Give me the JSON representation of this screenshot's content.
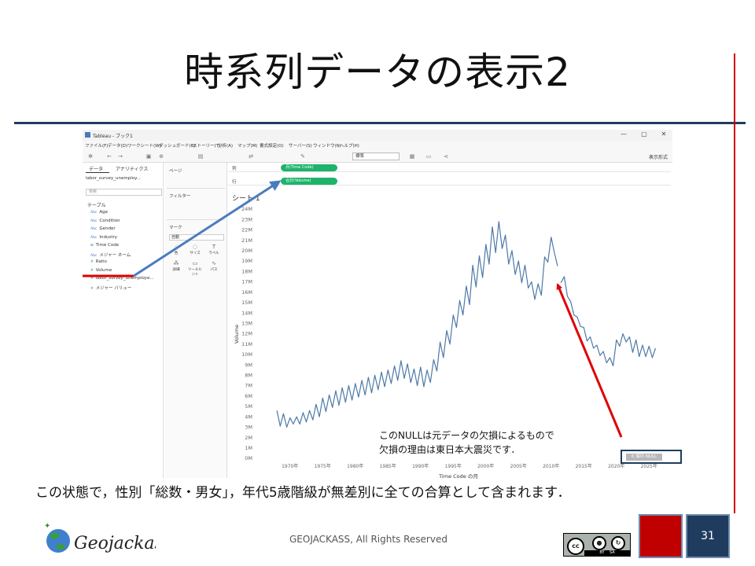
{
  "slide": {
    "title": "時系列データの表示2",
    "caption": "この状態で，性別「総数・男女」，年代5歳階級が無差別に全ての合算として含まれます．",
    "annotation_lines": [
      "このNULLは元データの欠損によるもので",
      "欠損の理由は東日本大震災です．"
    ],
    "footer": "GEOJACKASS, All Rights Reserved",
    "page_number": "31",
    "logo_text": "Geojackass",
    "license": {
      "cc": "cc",
      "by": "BY",
      "sa": "SA"
    },
    "colors": {
      "title_rule": "#1f3c5e",
      "vertical_rule": "#d40000",
      "arrow_red": "#e00000",
      "arrow_blue": "#4a7bc0",
      "accent_red": "#c00000",
      "accent_navy": "#1f3c5e"
    }
  },
  "tableau": {
    "window_title": "Tableau - ブック1",
    "window_buttons": [
      "—",
      "▢",
      "✕"
    ],
    "menu": [
      "ファイル(F)",
      "データ(D)",
      "ワークシート(W)",
      "ダッシュボード(B)",
      "ストーリー(T)",
      "分析(A)",
      "マップ(M)",
      "書式設定(O)",
      "サーバー(S)",
      "ウィンドウ(N)",
      "ヘルプ(H)"
    ],
    "toolbar": {
      "standard": "標準",
      "show_me": "表示形式"
    },
    "left_pane": {
      "tabs": [
        "データ",
        "アナリティクス"
      ],
      "source": "labor_survey_unemploy...",
      "search_placeholder": "検索",
      "table_heading": "テーブル",
      "fields": [
        {
          "icon": "Abc",
          "name": "Age",
          "kind": "dim"
        },
        {
          "icon": "Abc",
          "name": "Condition",
          "kind": "dim"
        },
        {
          "icon": "Abc",
          "name": "Gender",
          "kind": "dim"
        },
        {
          "icon": "Abc",
          "name": "Industry",
          "kind": "dim"
        },
        {
          "icon": "⊞",
          "name": "Time Code",
          "kind": "dim"
        },
        {
          "icon": "Abc",
          "name": "メジャー ネーム",
          "kind": "dim"
        },
        {
          "icon": "#",
          "name": "Ratio",
          "kind": "measure"
        },
        {
          "icon": "#",
          "name": "Volume",
          "kind": "measure"
        },
        {
          "icon": "#",
          "name": "labor_survey_unemploye...",
          "kind": "measure"
        },
        {
          "icon": "#",
          "name": "メジャー バリュー",
          "kind": "measure"
        }
      ]
    },
    "mid_pane": {
      "pages": "ページ",
      "filters": "フィルター",
      "marks": "マーク",
      "mark_type": "自動",
      "mark_buttons": [
        {
          "glyph": "⁘",
          "label": "色"
        },
        {
          "glyph": "◌",
          "label": "サイズ"
        },
        {
          "glyph": "T",
          "label": "ラベル"
        },
        {
          "glyph": "⁂",
          "label": "詳細"
        },
        {
          "glyph": "▭",
          "label": "ツールヒント"
        },
        {
          "glyph": "∿",
          "label": "パス"
        }
      ]
    },
    "shelves": {
      "columns_label": "列",
      "columns_pill": "月(Time Code)",
      "rows_label": "行",
      "rows_pill": "合計(Volume)"
    },
    "sheet_title": "シート 1",
    "null_indicator": "6 個の NULL"
  },
  "chart_data": {
    "type": "line",
    "title": "",
    "xlabel": "Time Code の月",
    "ylabel": "Volume",
    "x_ticks": [
      "1970年",
      "1975年",
      "1980年",
      "1985年",
      "1990年",
      "1995年",
      "2000年",
      "2005年",
      "2010年",
      "2015年",
      "2020年",
      "2025年"
    ],
    "x_tick_values": [
      1970,
      1975,
      1980,
      1985,
      1990,
      1995,
      2000,
      2005,
      2010,
      2015,
      2020,
      2025
    ],
    "y_ticks": [
      "0M",
      "1M",
      "2M",
      "3M",
      "4M",
      "5M",
      "6M",
      "7M",
      "8M",
      "9M",
      "10M",
      "11M",
      "12M",
      "13M",
      "14M",
      "15M",
      "16M",
      "17M",
      "18M",
      "19M",
      "20M",
      "21M",
      "22M",
      "23M",
      "24M"
    ],
    "xlim": [
      1967.5,
      2027.5
    ],
    "ylim": [
      0,
      24
    ],
    "grid": false,
    "series": [
      {
        "color": "#4e79a7",
        "segments": [
          {
            "x": [
              1968.0,
              1968.5,
              1969.0,
              1969.5,
              1970.0,
              1970.5,
              1971.0,
              1971.5,
              1972.0,
              1972.5,
              1973.0,
              1973.5,
              1974.0,
              1974.5,
              1975.0,
              1975.5,
              1976.0,
              1976.5,
              1977.0,
              1977.5,
              1978.0,
              1978.5,
              1979.0,
              1979.5,
              1980.0,
              1980.5,
              1981.0,
              1981.5,
              1982.0,
              1982.5,
              1983.0,
              1983.5,
              1984.0,
              1984.5,
              1985.0,
              1985.5,
              1986.0,
              1986.5,
              1987.0,
              1987.5,
              1988.0,
              1988.5,
              1989.0,
              1989.5,
              1990.0,
              1990.5,
              1991.0,
              1991.5,
              1992.0,
              1992.5,
              1993.0,
              1993.5,
              1994.0,
              1994.5,
              1995.0,
              1995.5,
              1996.0,
              1996.5,
              1997.0,
              1997.5,
              1998.0,
              1998.5,
              1999.0,
              1999.5,
              2000.0,
              2000.5,
              2001.0,
              2001.5,
              2002.0,
              2002.5,
              2003.0,
              2003.5,
              2004.0,
              2004.5,
              2005.0,
              2005.5,
              2006.0,
              2006.5,
              2007.0,
              2007.5,
              2008.0,
              2008.5,
              2009.0,
              2009.5,
              2010.0,
              2010.5,
              2011.0
            ],
            "y": [
              4.6,
              3.1,
              4.3,
              3.0,
              3.9,
              3.3,
              4.0,
              3.3,
              4.4,
              3.5,
              4.6,
              3.7,
              5.2,
              4.0,
              5.8,
              4.5,
              6.1,
              4.9,
              6.5,
              5.1,
              6.8,
              5.4,
              7.0,
              5.6,
              7.2,
              5.9,
              7.5,
              6.1,
              7.8,
              6.3,
              8.0,
              6.6,
              8.3,
              6.9,
              8.5,
              7.2,
              8.9,
              7.5,
              9.4,
              7.7,
              9.1,
              7.3,
              8.6,
              7.0,
              8.8,
              6.9,
              8.5,
              7.3,
              9.5,
              8.4,
              11.2,
              9.7,
              12.3,
              11.0,
              13.8,
              12.6,
              15.2,
              13.8,
              16.6,
              14.8,
              18.6,
              16.5,
              19.5,
              17.4,
              20.6,
              18.7,
              22.3,
              19.8,
              22.8,
              20.2,
              21.5,
              18.7,
              20.0,
              17.7,
              19.0,
              16.9,
              18.6,
              16.4,
              17.0,
              15.3,
              16.8,
              15.7,
              19.4,
              18.9,
              21.3,
              19.8,
              18.5
            ]
          },
          {
            "x": [
              2011.5,
              2012.0,
              2012.5,
              2013.0,
              2013.5,
              2014.0,
              2014.5,
              2015.0,
              2015.5,
              2016.0,
              2016.5,
              2017.0,
              2017.5,
              2018.0,
              2018.5,
              2019.0,
              2019.5,
              2020.0,
              2020.5,
              2021.0,
              2021.5,
              2022.0,
              2022.5,
              2023.0,
              2023.5,
              2024.0,
              2024.5,
              2025.0,
              2025.5,
              2026.0
            ],
            "y": [
              16.9,
              17.5,
              15.6,
              15.1,
              13.8,
              13.6,
              12.7,
              12.6,
              11.3,
              11.7,
              10.6,
              10.9,
              9.9,
              10.3,
              9.2,
              9.7,
              8.9,
              11.4,
              10.8,
              12.0,
              11.2,
              11.7,
              10.2,
              11.4,
              9.8,
              10.9,
              9.8,
              10.8,
              9.7,
              10.6
            ]
          }
        ]
      }
    ]
  }
}
